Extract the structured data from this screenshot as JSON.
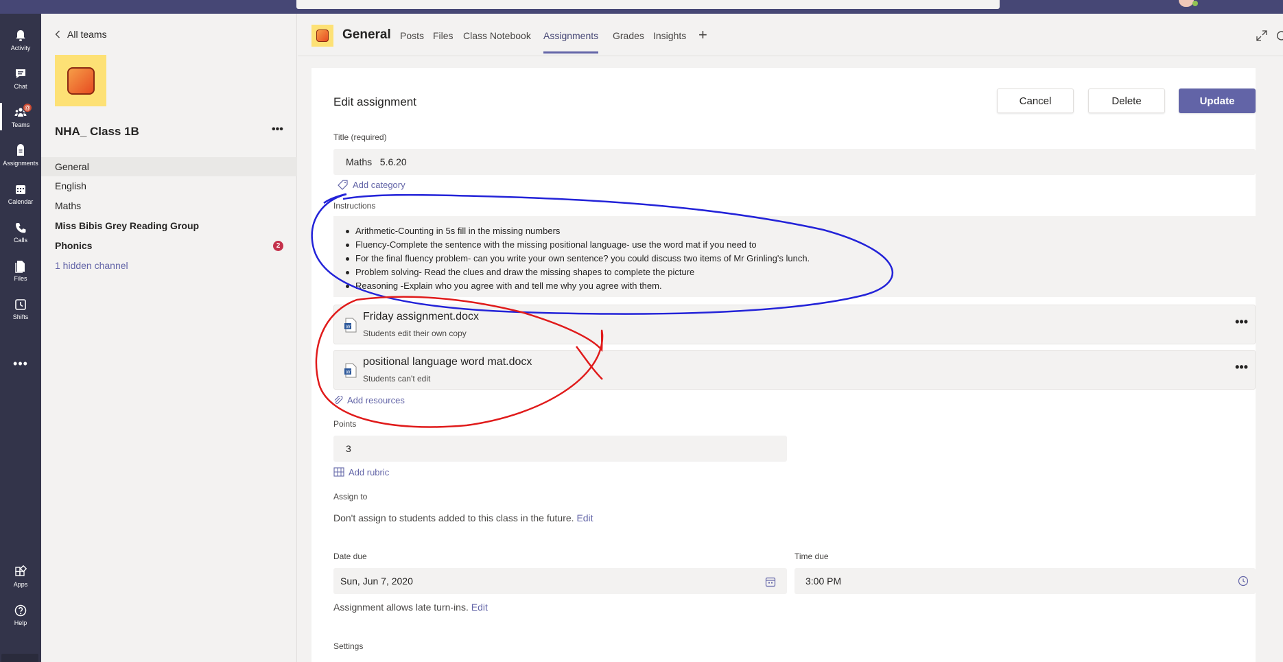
{
  "rail": {
    "items": [
      {
        "label": "Activity",
        "icon": "bell-icon"
      },
      {
        "label": "Chat",
        "icon": "chat-icon"
      },
      {
        "label": "Teams",
        "icon": "teams-icon",
        "badge": "@"
      },
      {
        "label": "Assignments",
        "icon": "assignments-icon"
      },
      {
        "label": "Calendar",
        "icon": "calendar-icon"
      },
      {
        "label": "Calls",
        "icon": "phone-icon"
      },
      {
        "label": "Files",
        "icon": "file-icon"
      },
      {
        "label": "Shifts",
        "icon": "clock-icon"
      }
    ],
    "more": "•••",
    "apps_label": "Apps",
    "help_label": "Help"
  },
  "pane": {
    "back_label": "All teams",
    "team_name": "NHA_ Class 1B",
    "more": "•••",
    "channels": [
      {
        "label": "General"
      },
      {
        "label": "English"
      },
      {
        "label": "Maths"
      },
      {
        "label": "Miss Bibis Grey Reading Group"
      },
      {
        "label": "Phonics",
        "badge": "2"
      }
    ],
    "hidden": "1 hidden channel"
  },
  "tabs": {
    "channel": "General",
    "items": [
      "Posts",
      "Files",
      "Class Notebook",
      "Assignments",
      "Grades",
      "Insights"
    ],
    "active": "Assignments",
    "add": "+"
  },
  "form": {
    "heading": "Edit assignment",
    "cancel": "Cancel",
    "delete": "Delete",
    "update": "Update",
    "title_label": "Title (required)",
    "title_value": "Maths   5.6.20",
    "add_category": "Add category",
    "instructions_label": "Instructions",
    "instructions": [
      "Arithmetic-Counting in 5s fill in the missing numbers",
      "Fluency-Complete the sentence with the missing positional language- use the word mat if you need to",
      "For the final fluency problem- can you write your own sentence? you could discuss two items of Mr Grinling's lunch.",
      "Problem solving- Read the clues and draw the missing shapes to complete the picture",
      "Reasoning -Explain who you agree with and tell me why you agree with them."
    ],
    "files": [
      {
        "name": "Friday assignment.docx",
        "sub": "Students edit their own copy",
        "more": "•••"
      },
      {
        "name": "positional language word mat.docx",
        "sub": "Students can't edit",
        "more": "•••"
      }
    ],
    "add_resources": "Add resources",
    "points_label": "Points",
    "points_value": "3",
    "add_rubric": "Add rubric",
    "assign_label": "Assign to",
    "assign_text": "Don't assign to students added to this class in the future.",
    "assign_edit": "Edit",
    "date_label": "Date due",
    "date_value": "Sun, Jun 7, 2020",
    "time_label": "Time due",
    "time_value": "3:00 PM",
    "late_text": "Assignment allows late turn-ins.",
    "late_edit": "Edit",
    "settings_label": "Settings"
  },
  "colors": {
    "accent": "#6264a7",
    "rail": "#33344a",
    "topbar": "#464775",
    "annotation_blue": "#2323d8",
    "annotation_red": "#e01b1b"
  }
}
